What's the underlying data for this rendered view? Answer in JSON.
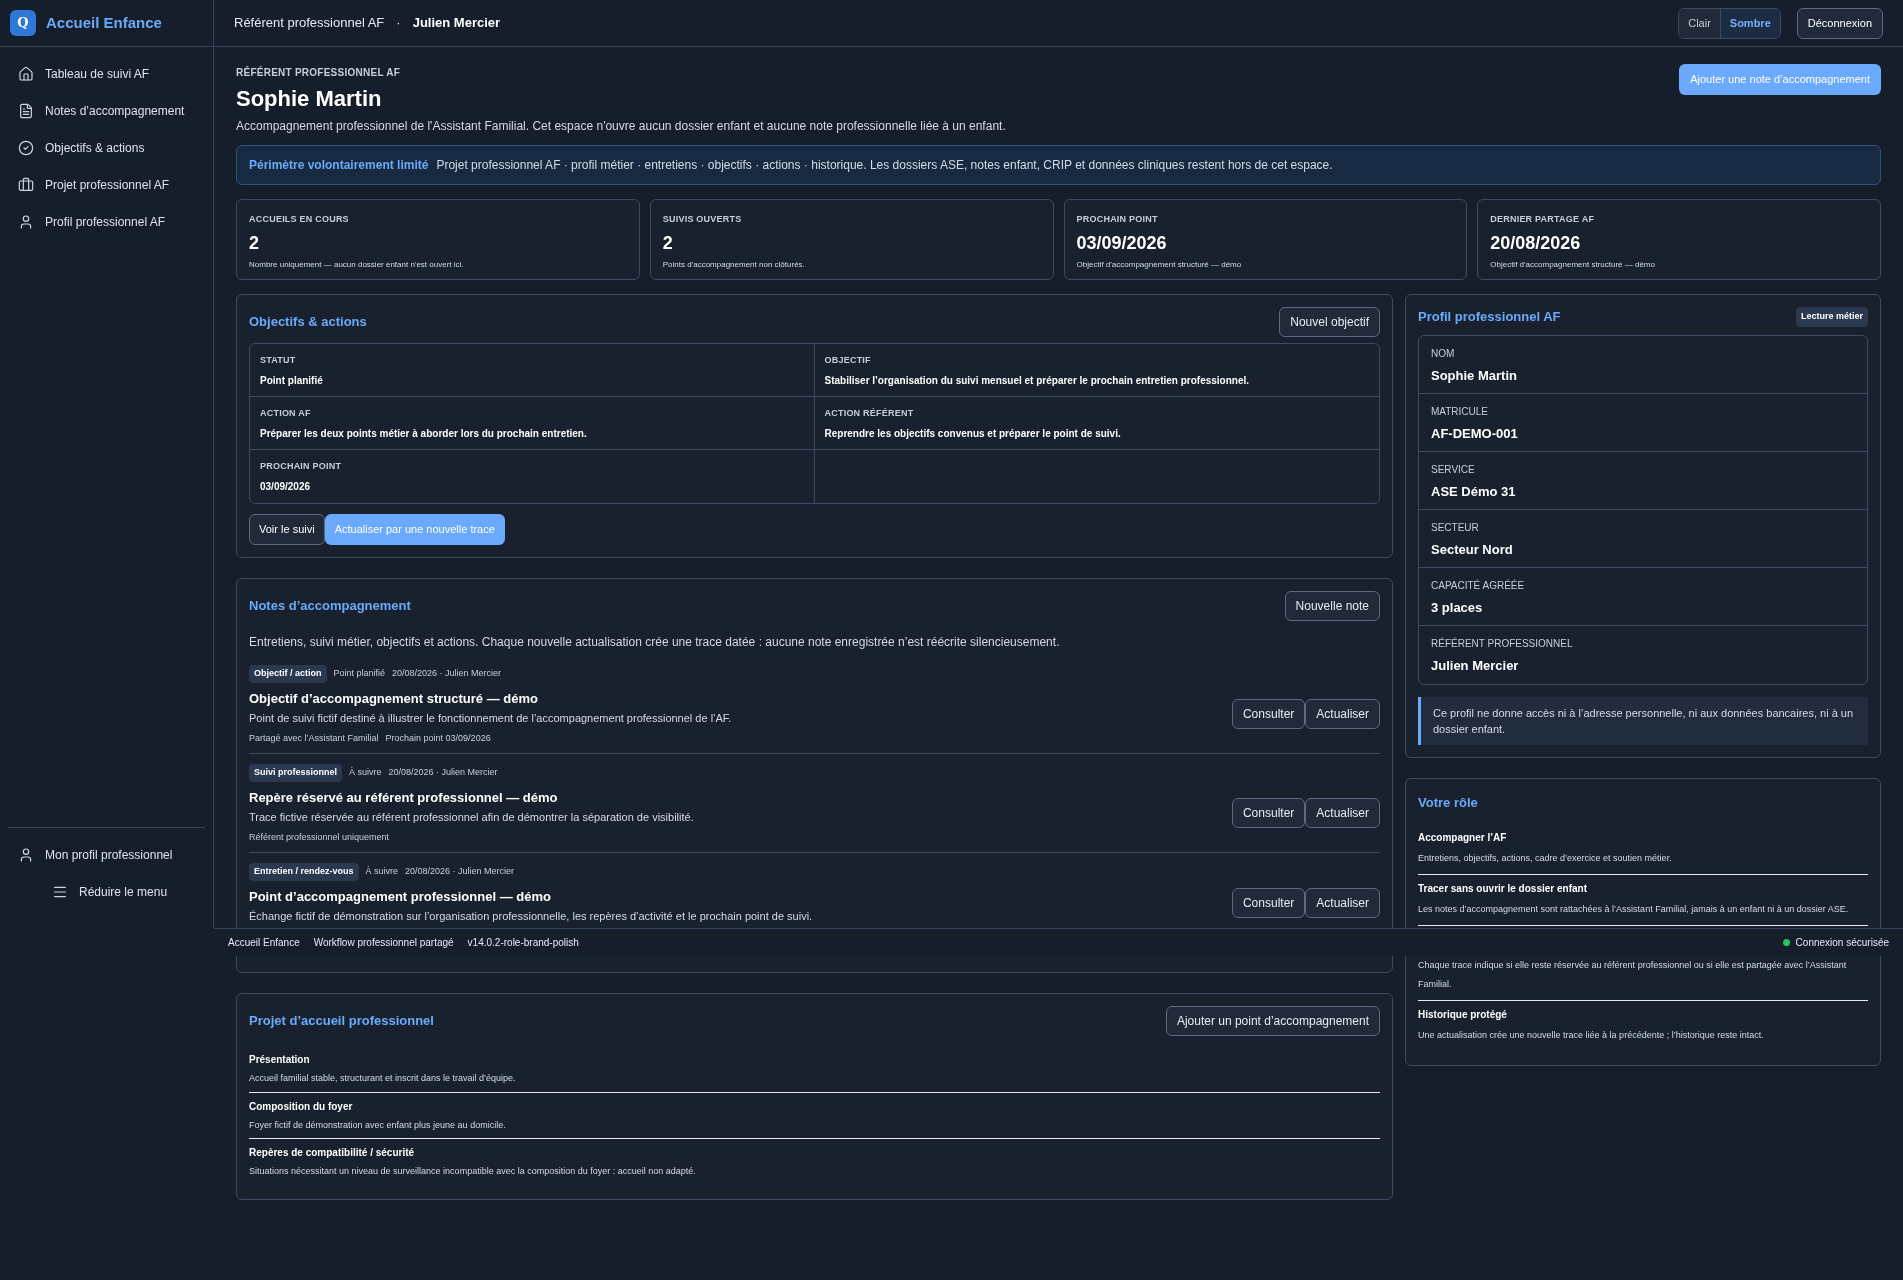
{
  "brand": {
    "logo": "Q",
    "name": "Accueil Enfance"
  },
  "sidebar": {
    "items": [
      {
        "label": "Tableau de suivi AF",
        "kind": "home"
      },
      {
        "label": "Notes d’accompagnement",
        "kind": "document"
      },
      {
        "label": "Objectifs & actions",
        "kind": "check"
      },
      {
        "label": "Projet professionnel AF",
        "kind": "briefcase"
      },
      {
        "label": "Profil professionnel AF",
        "kind": "user"
      }
    ],
    "bottom_items": [
      {
        "label": "Mon profil professionnel",
        "kind": "user"
      },
      {
        "label": "Réduire le menu",
        "kind": "menu"
      }
    ]
  },
  "header": {
    "role": "Référent professionnel AF",
    "separator": "·",
    "user": "Julien Mercier",
    "theme_toggle": [
      {
        "label": "Clair",
        "selected": false
      },
      {
        "label": "Sombre",
        "selected": true
      }
    ],
    "logout": "Déconnexion"
  },
  "page": {
    "eyebrow": "RÉFÉRENT PROFESSIONNEL AF",
    "title": "Sophie Martin",
    "description": "Accompagnement professionnel de l'Assistant Familial. Cet espace n'ouvre aucun dossier enfant et aucune note professionnelle liée à un enfant.",
    "primary_button": "Ajouter une note d’accompagnement",
    "notice": {
      "label": "Périmètre volontairement limité",
      "text": "Projet professionnel AF · profil métier · entretiens · objectifs · actions · historique. Les dossiers ASE, notes enfant, CRIP et données cliniques restent hors de cet espace."
    }
  },
  "stats": [
    {
      "label": "ACCUEILS EN COURS",
      "value": "2",
      "caption": "Nombre uniquement — aucun dossier enfant n'est ouvert ici."
    },
    {
      "label": "SUIVIS OUVERTS",
      "value": "2",
      "caption": "Points d'accompagnement non clôturés."
    },
    {
      "label": "PROCHAIN POINT",
      "value": "03/09/2026",
      "caption": "Objectif d'accompagnement structuré — démo"
    },
    {
      "label": "DERNIER PARTAGE AF",
      "value": "20/08/2026",
      "caption": "Objectif d'accompagnement structuré — démo"
    }
  ],
  "objectives": {
    "title": "Objectifs & actions",
    "button": "Nouvel objectif",
    "fields": [
      {
        "label": "STATUT",
        "value": "Point planifié"
      },
      {
        "label": "OBJECTIF",
        "value": "Stabiliser l’organisation du suivi mensuel et préparer le prochain entretien professionnel."
      },
      {
        "label": "ACTION AF",
        "value": "Préparer les deux points métier à aborder lors du prochain entretien."
      },
      {
        "label": "ACTION RÉFÉRENT",
        "value": "Reprendre les objectifs convenus et préparer le point de suivi."
      },
      {
        "label": "PROCHAIN POINT",
        "value": "03/09/2026"
      }
    ],
    "actions": [
      {
        "label": "Voir le suivi",
        "kind": "secondary"
      },
      {
        "label": "Actualiser par une nouvelle trace",
        "kind": "primary"
      }
    ]
  },
  "notes": {
    "title": "Notes d’accompagnement",
    "button": "Nouvelle note",
    "intro": "Entretiens, suivi métier, objectifs et actions. Chaque nouvelle actualisation crée une trace datée : aucune note enregistrée n’est réécrite silencieusement.",
    "items": [
      {
        "tag": "Objectif / action",
        "status": "Point planifié",
        "meta": "20/08/2026 · Julien Mercier",
        "title": "Objectif d’accompagnement structuré — démo",
        "description": "Point de suivi fictif destiné à illustrer le fonctionnement de l’accompagnement professionnel de l’AF.",
        "footer": [
          "Partagé avec l’Assistant Familial",
          "Prochain point 03/09/2026"
        ],
        "buttons": [
          "Consulter",
          "Actualiser"
        ]
      },
      {
        "tag": "Suivi professionnel",
        "status": "À suivre",
        "meta": "20/08/2026 · Julien Mercier",
        "title": "Repère réservé au référent professionnel — démo",
        "description": "Trace fictive réservée au référent professionnel afin de démontrer la séparation de visibilité.",
        "footer": [
          "Référent professionnel uniquement"
        ],
        "buttons": [
          "Consulter",
          "Actualiser"
        ]
      },
      {
        "tag": "Entretien / rendez-vous",
        "status": "À suivre",
        "meta": "20/08/2026 · Julien Mercier",
        "title": "Point d’accompagnement professionnel — démo",
        "description": "Échange fictif de démonstration sur l’organisation professionnelle, les repères d’activité et le prochain point de suivi.",
        "buttons": [
          "Consulter",
          "Actualiser"
        ]
      }
    ]
  },
  "project": {
    "title": "Projet d’accueil professionnel",
    "button": "Ajouter un point d’accompagnement",
    "sections": [
      {
        "title": "Présentation",
        "text": "Accueil familial stable, structurant et inscrit dans le travail d’équipe."
      },
      {
        "title": "Composition du foyer",
        "text": "Foyer fictif de démonstration avec enfant plus jeune au domicile."
      },
      {
        "title": "Repères de compatibilité / sécurité",
        "text": "Situations nécessitant un niveau de surveillance incompatible avec la composition du foyer : accueil non adapté."
      }
    ]
  },
  "profile": {
    "title": "Profil professionnel AF",
    "badge": "Lecture métier",
    "fields": [
      {
        "label": "NOM",
        "value": "Sophie Martin"
      },
      {
        "label": "MATRICULE",
        "value": "AF-DEMO-001"
      },
      {
        "label": "SERVICE",
        "value": "ASE Démo 31"
      },
      {
        "label": "SECTEUR",
        "value": "Secteur Nord"
      },
      {
        "label": "CAPACITÉ AGRÉÉE",
        "value": "3 places"
      },
      {
        "label": "RÉFÉRENT PROFESSIONNEL",
        "value": "Julien Mercier"
      }
    ],
    "note": "Ce profil ne donne accès ni à l’adresse personnelle, ni aux données bancaires, ni à un dossier enfant."
  },
  "role": {
    "title": "Votre rôle",
    "items": [
      {
        "title": "Accompagner l’AF",
        "text": "Entretiens, objectifs, actions, cadre d’exercice et soutien métier."
      },
      {
        "title": "Tracer sans ouvrir le dossier enfant",
        "text": "Les notes d’accompagnement sont rattachées à l’Assistant Familial, jamais à un enfant ni à un dossier ASE."
      },
      {
        "text": "Chaque trace indique si elle reste réservée au référent professionnel ou si elle est partagée avec l’Assistant Familial."
      },
      {
        "title": "Historique protégé",
        "text": "Une actualisation crée une nouvelle trace liée à la précédente ; l’historique reste intact."
      }
    ]
  },
  "footer": {
    "items": [
      "Accueil Enfance",
      "Workflow professionnel partagé",
      "v14.0.2-role-brand-polish"
    ],
    "status": {
      "label": "Connexion sécurisée",
      "color": "#22c55e"
    }
  }
}
